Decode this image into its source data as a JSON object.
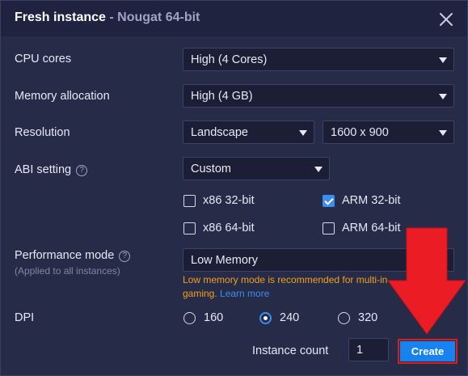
{
  "dialog": {
    "title": "Fresh instance",
    "subtitle": " - Nougat 64-bit",
    "close_icon": "close-icon"
  },
  "cpu": {
    "label": "CPU cores",
    "value": "High (4 Cores)"
  },
  "memory": {
    "label": "Memory allocation",
    "value": "High (4 GB)"
  },
  "resolution": {
    "label": "Resolution",
    "orientation": "Landscape",
    "size": "1600 x 900"
  },
  "abi": {
    "label": "ABI setting",
    "help": "?",
    "value": "Custom",
    "options": [
      {
        "label": "x86 32-bit",
        "checked": false
      },
      {
        "label": "ARM 32-bit",
        "checked": true
      },
      {
        "label": "x86 64-bit",
        "checked": false
      },
      {
        "label": "ARM 64-bit",
        "checked": false
      }
    ]
  },
  "performance": {
    "label": "Performance mode",
    "help": "?",
    "sublabel": "(Applied to all instances)",
    "value": "Low Memory",
    "warning_line1": "Low memory mode is recommended for multi-in",
    "warning_line2": "gaming. ",
    "learn_more": "Learn more"
  },
  "dpi": {
    "label": "DPI",
    "options": [
      {
        "label": "160",
        "selected": false
      },
      {
        "label": "240",
        "selected": true
      },
      {
        "label": "320",
        "selected": false
      }
    ]
  },
  "instance_count": {
    "label": "Instance count",
    "value": "1"
  },
  "create_button": {
    "label": "Create"
  },
  "colors": {
    "accent": "#1783f0",
    "warning": "#f0a020",
    "highlight_red": "#e01919"
  }
}
